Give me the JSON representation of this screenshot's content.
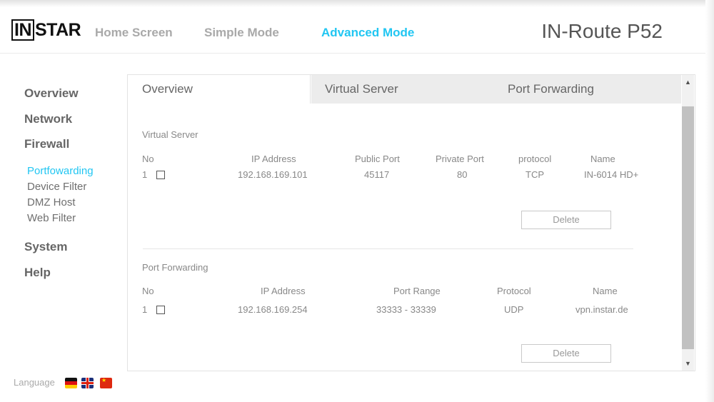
{
  "header": {
    "logo_boxed": "IN",
    "logo_rest": "STAR",
    "nav": [
      "Home Screen",
      "Simple Mode",
      "Advanced Mode"
    ],
    "product": "IN-Route P52"
  },
  "sidebar": {
    "main": [
      "Overview",
      "Network",
      "Firewall",
      "System",
      "Help"
    ],
    "firewall_sub": [
      "Portfowarding",
      "Device Filter",
      "DMZ Host",
      "Web Filter"
    ],
    "active_sub": "Portfowarding"
  },
  "language": {
    "label": "Language",
    "flags": [
      "flag-de-icon",
      "flag-uk-icon",
      "flag-cn-icon"
    ]
  },
  "panel": {
    "tabs": [
      "Overview",
      "Virtual Server",
      "Port Forwarding"
    ],
    "virtual_server": {
      "title": "Virtual Server",
      "columns": [
        "No",
        "IP Address",
        "Public Port",
        "Private Port",
        "protocol",
        "Name"
      ],
      "rows": [
        {
          "no": "1",
          "ip": "192.168.169.101",
          "public_port": "45117",
          "private_port": "80",
          "protocol": "TCP",
          "name": "IN-6014 HD+"
        }
      ],
      "delete_label": "Delete"
    },
    "port_forwarding": {
      "title": "Port Forwarding",
      "columns": [
        "No",
        "IP Address",
        "Port Range",
        "Protocol",
        "Name"
      ],
      "rows": [
        {
          "no": "1",
          "ip": "192.168.169.254",
          "port_range": "33333 - 33339",
          "protocol": "UDP",
          "name": "vpn.instar.de"
        }
      ],
      "delete_label": "Delete"
    }
  },
  "colors": {
    "accent": "#21c6f2",
    "text": "#888888"
  }
}
